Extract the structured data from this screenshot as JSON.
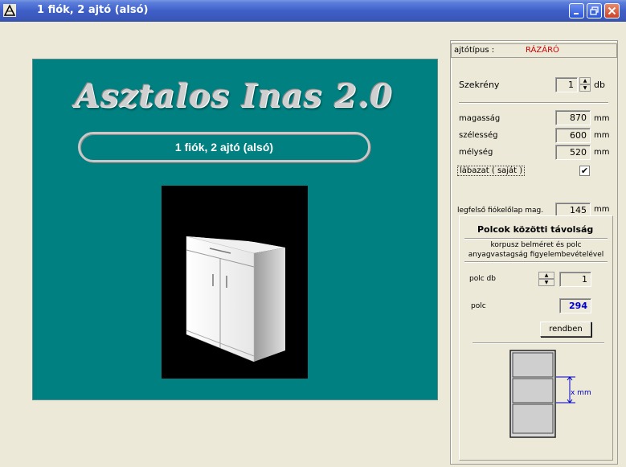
{
  "window": {
    "title": "1 fiók, 2 ajtó (alsó)"
  },
  "main": {
    "logo_text": "Asztalos Inas 2.0",
    "subtitle": "1 fiók, 2 ajtó (alsó)"
  },
  "side": {
    "door_type_label": "ajtótípus :",
    "door_type_value": "RÁZÁRÓ",
    "cabinet_label": "Szekrény",
    "cabinet_count": "1",
    "cabinet_unit": "db",
    "height_label": "magasság",
    "height_value": "870",
    "width_label": "szélesség",
    "width_value": "600",
    "depth_label": "mélység",
    "depth_value": "520",
    "unit_mm": "mm",
    "base_label": "lábazat     ( saját )",
    "base_checked": "✔",
    "top_drawer_label": "legfelső fiókelőlap mag.",
    "top_drawer_value": "145"
  },
  "shelf": {
    "title": "Polcok közötti távolság",
    "note": "korpusz belméret és polc anyagvastagság figyelembevételével",
    "count_label": "polc db",
    "count_value": "1",
    "shelf_label": "polc",
    "shelf_value": "294",
    "ok_button": "rendben",
    "dim_label": "x  mm"
  },
  "colors": {
    "accent_red": "#cc0000",
    "accent_blue": "#0000cc",
    "teal": "#008080"
  }
}
